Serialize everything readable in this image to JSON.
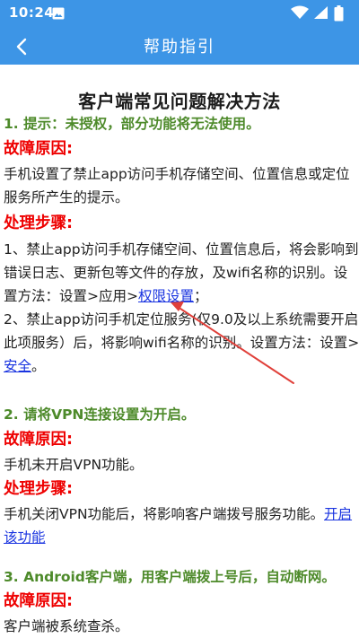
{
  "status_bar": {
    "time": "10:24",
    "icons": [
      "gallery-icon",
      "wifi-icon",
      "signal-icon",
      "battery-icon"
    ]
  },
  "app_bar": {
    "title": "帮助指引",
    "back_icon": "chevron-left-icon"
  },
  "colors": {
    "primary": "#3d95e6",
    "section_title": "#4d8a2a",
    "heading_red": "#ee0000",
    "link": "#1a34e0",
    "arrow": "#e0403a"
  },
  "doc": {
    "title": "客户端常见问题解决方法",
    "s1": {
      "title": "1. 提示：未授权，部分功能将无法使用。",
      "cause_head": "故障原因:",
      "cause_l1": "手机设置了禁止app访问手机存储空间、位置信息或定位",
      "cause_l2": "服务所产生的提示。",
      "steps_head": "处理步骤:",
      "step_l1": "1、禁止app访问手机存储空间、位置信息后，将会影响到",
      "step_l2": "错误日志、更新包等文件的存放，及wifi名称的识别。设",
      "step_l3_pre": "置方法：设置>应用>",
      "step_l3_link": "权限设置",
      "step_l3_post": "；",
      "step_l4": "2、禁止app访问手机定位服务(仅9.0及以上系统需要开启",
      "step_l5": "此项服务）后，将影响wifi名称的识别。设置方法：设置>",
      "step_l6_link": "安全",
      "step_l6_post": "。"
    },
    "s2": {
      "title": "2. 请将VPN连接设置为开启。",
      "cause_head": "故障原因:",
      "cause_l1": "手机未开启VPN功能。",
      "steps_head": "处理步骤:",
      "step_l1_pre": "手机关闭VPN功能后，将影响客户端拨号服务功能。",
      "step_l1_link": "开启",
      "step_l2_link": "该功能"
    },
    "s3": {
      "title": "3. Android客户端，用客户端拨上号后，自动断网。",
      "cause_head": "故障原因:",
      "cause_l1": "客户端被系统查杀。"
    }
  }
}
